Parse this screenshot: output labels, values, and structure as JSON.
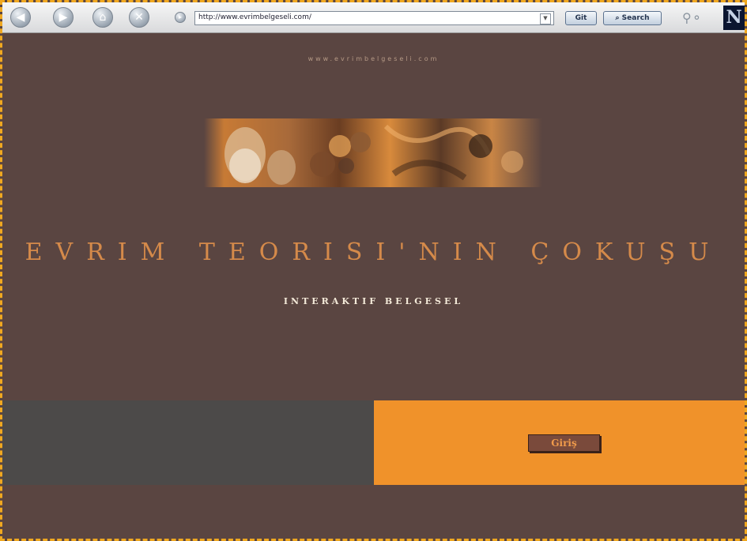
{
  "browser": {
    "address_url": "http://www.evrimbelgeseli.com/",
    "go_label": "Git",
    "search_label": "Search",
    "logo_letter": "N"
  },
  "page": {
    "site_url": "www.evrimbelgeseli.com",
    "title": "EVRIM TEORISI'NIN ÇOKUŞU",
    "subtitle": "INTERAKTIF BELGESEL",
    "enter_label": "Giriş"
  },
  "colors": {
    "page_bg": "#5a4541",
    "accent_orange": "#f0922a",
    "title_color": "#d58a4a",
    "bottom_band": "#4c4a49"
  }
}
